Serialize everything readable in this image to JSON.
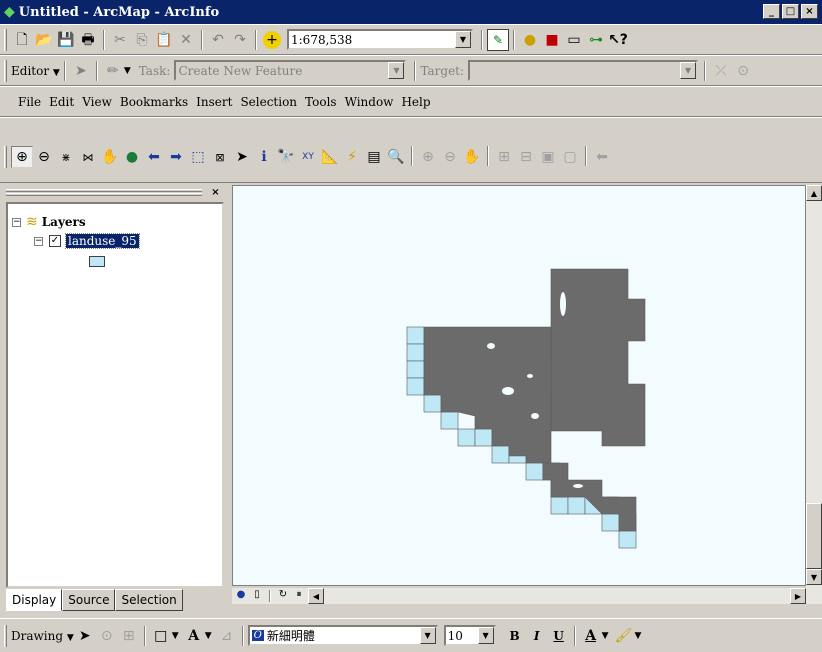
{
  "window": {
    "title": "Untitled - ArcMap - ArcInfo",
    "controls": [
      "_",
      "□",
      "×"
    ]
  },
  "standard_toolbar": {
    "scale_value": "1:678,538"
  },
  "editor_toolbar": {
    "editor_label": "Editor",
    "task_label": "Task:",
    "task_value": "Create New Feature",
    "target_label": "Target:",
    "target_value": ""
  },
  "menu": {
    "items": [
      "File",
      "Edit",
      "View",
      "Bookmarks",
      "Insert",
      "Selection",
      "Tools",
      "Window",
      "Help"
    ]
  },
  "toc": {
    "root_label": "Layers",
    "layer_label": "landuse_95",
    "layer_checked": true,
    "symbol_color": "#bfe8f7"
  },
  "toc_tabs": [
    "Display",
    "Source",
    "Selection"
  ],
  "map": {
    "background": "#f2fbfd",
    "feature_color": "#6b6b6b",
    "tile_color": "#bfe8f7"
  },
  "drawing_toolbar": {
    "drawing_label": "Drawing",
    "font_name": "新細明體",
    "font_size": "10",
    "bold": "B",
    "italic": "I",
    "underline": "U",
    "font_color_letter": "A",
    "text_tool_letter": "A"
  }
}
